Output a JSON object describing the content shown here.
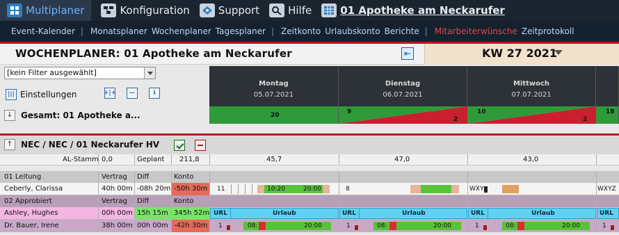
{
  "nav": {
    "top": [
      {
        "label": "Multiplaner",
        "icon": "multiplaner-icon"
      },
      {
        "label": "Konfiguration",
        "icon": "konfiguration-icon"
      },
      {
        "label": "Support",
        "icon": "support-icon"
      },
      {
        "label": "Hilfe",
        "icon": "search-help-icon"
      },
      {
        "label": "01 Apotheke am Neckarufer",
        "icon": "pharmacy-grid-icon"
      }
    ],
    "sub": [
      {
        "label": "Event-Kalender"
      },
      {
        "label": "Monatsplaner"
      },
      {
        "label": "Wochenplaner"
      },
      {
        "label": "Tagesplaner"
      },
      {
        "label": "Zeitkonto"
      },
      {
        "label": "Urlaubskonto"
      },
      {
        "label": "Berichte"
      },
      {
        "label": "Mitarbeiterwünsche"
      },
      {
        "label": "Zeitprotokoll"
      }
    ],
    "sub_separator": "|",
    "active_color": "#e04848"
  },
  "page": {
    "title": "WOCHENPLANER: 01 Apotheke am Neckarufer",
    "week": "KW  27 2021",
    "filter": "[kein Filter ausgewählt]",
    "settings_label": "Einstellungen",
    "expand_icon_label": "+|+",
    "collapse_icon_label": "--",
    "info_icon_label": "i"
  },
  "days": [
    {
      "name": "Montag",
      "date": "05.07.2021",
      "total_left": "20",
      "total_right": "",
      "status": "green",
      "al": "45,7"
    },
    {
      "name": "Dienstag",
      "date": "06.07.2021",
      "total_left": "9",
      "total_right": "2",
      "status": "mixed",
      "al": "47,0"
    },
    {
      "name": "Mittwoch",
      "date": "07.07.2021",
      "total_left": "10",
      "total_right": "2",
      "status": "mixed",
      "al": "43,0"
    },
    {
      "name": "",
      "date": "",
      "total_left": "18",
      "total_right": "",
      "status": "green",
      "al": ""
    }
  ],
  "gesamt": {
    "label": "Gesamt: 01 Apotheke a..."
  },
  "group": {
    "title": "NEC / NEC / 01 Neckarufer HV",
    "al_label": "AL-Stamm",
    "al_value": "0,0",
    "geplant_label": "Geplant",
    "geplant_value": "211,8"
  },
  "table": {
    "section_leitung": "01 Leitung",
    "section_approbiert": "02 Approbiert",
    "headers": {
      "vertrag": "Vertrag",
      "diff": "Diff",
      "konto": "Konto"
    },
    "rows": [
      {
        "name": "Ceberly, Clarissa",
        "vertrag": "40h 00m",
        "diff": "-08h 20m",
        "konto": "-50h 30m",
        "mon_code": "11",
        "mon_start": "10:20",
        "mon_end": "20:00",
        "tue_code": "8",
        "wed_code": "WXY",
        "thu_code": "WXYZ"
      },
      {
        "name": "Ashley, Hughes",
        "vertrag": "00h 00m",
        "diff": "15h 15m",
        "konto": "345h 52m",
        "url_label": "URL",
        "urlaub_label": "Urlaub"
      },
      {
        "name": "Dr. Bauer, Irene",
        "vertrag": "38h 00m",
        "diff": "00h 00m",
        "konto": "-42h 30m",
        "mon_code": "1",
        "mon_start": "08:",
        "mon_end": "20:00",
        "tue_code": "1",
        "tue_start": "08:",
        "tue_end": "20:00",
        "wed_code": "1",
        "wed_start": "08:",
        "wed_end": "20:00",
        "thu_code": "1"
      }
    ]
  },
  "colors": {
    "total_green": "#2f9a3a",
    "total_red": "#c8202e",
    "shift_green": "#58c23a",
    "shift_tan": "#e6b59a",
    "url_blue": "#5fd2f1",
    "neg_konto": "#e46a5a",
    "pos_diff": "#7be36a"
  }
}
